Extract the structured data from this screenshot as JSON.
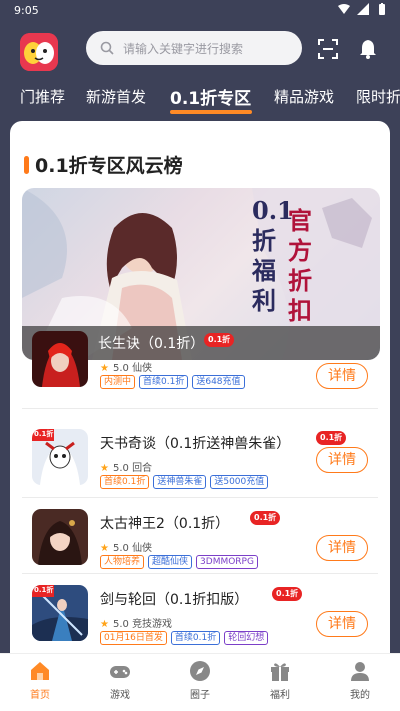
{
  "status_bar": {
    "time": "9:05"
  },
  "search": {
    "placeholder": "请输入关键字进行搜索"
  },
  "tabs": [
    {
      "label": "门推荐"
    },
    {
      "label": "新游首发"
    },
    {
      "label": "0.1折专区"
    },
    {
      "label": "精品游戏"
    },
    {
      "label": "限时折"
    }
  ],
  "section": {
    "title": "0.1折专区风云榜"
  },
  "banner": {
    "text_right": "官方折扣",
    "text_left": "0.1折福利",
    "caption": "长生诀（0.1折）"
  },
  "games": [
    {
      "name": "长生诀（0.1折）",
      "badge": "0.1折",
      "rating": "5.0",
      "genre": "仙侠",
      "tags": [
        {
          "text": "内测中",
          "color": "#ff7a1a"
        },
        {
          "text": "首续0.1折",
          "color": "#3b6fd8"
        },
        {
          "text": "送648充值",
          "color": "#3b6fd8"
        }
      ],
      "button": "详情"
    },
    {
      "name": "天书奇谈（0.1折送神兽朱雀）",
      "badge": "0.1折",
      "rating": "5.0",
      "genre": "回合",
      "icon_badge": "0.1折",
      "tags": [
        {
          "text": "首续0.1折",
          "color": "#ff7a1a"
        },
        {
          "text": "送神兽朱雀",
          "color": "#3b6fd8"
        },
        {
          "text": "送5000充值",
          "color": "#3b6fd8"
        }
      ],
      "button": "详情"
    },
    {
      "name": "太古神王2（0.1折）",
      "badge": "0.1折",
      "rating": "5.0",
      "genre": "仙侠",
      "tags": [
        {
          "text": "人物培养",
          "color": "#ff7a1a"
        },
        {
          "text": "超酷仙侠",
          "color": "#3b6fd8"
        },
        {
          "text": "3DMMORPG",
          "color": "#7b3fc8"
        }
      ],
      "button": "详情"
    },
    {
      "name": "剑与轮回（0.1折扣版）",
      "badge": "0.1折",
      "rating": "5.0",
      "genre": "竞技游戏",
      "icon_badge": "0.1折",
      "tags": [
        {
          "text": "01月16日首发",
          "color": "#ff7a1a"
        },
        {
          "text": "首续0.1折",
          "color": "#3b6fd8"
        },
        {
          "text": "轮回幻想",
          "color": "#7b3fc8"
        }
      ],
      "button": "详情"
    }
  ],
  "bottom_nav": [
    {
      "label": "首页",
      "icon": "home-icon"
    },
    {
      "label": "游戏",
      "icon": "gamepad-icon"
    },
    {
      "label": "圈子",
      "icon": "compass-icon"
    },
    {
      "label": "福利",
      "icon": "gift-icon"
    },
    {
      "label": "我的",
      "icon": "user-icon"
    }
  ],
  "colors": {
    "accent": "#ff7a1a",
    "badge": "#e82424",
    "header_bg": "#3d4158"
  }
}
